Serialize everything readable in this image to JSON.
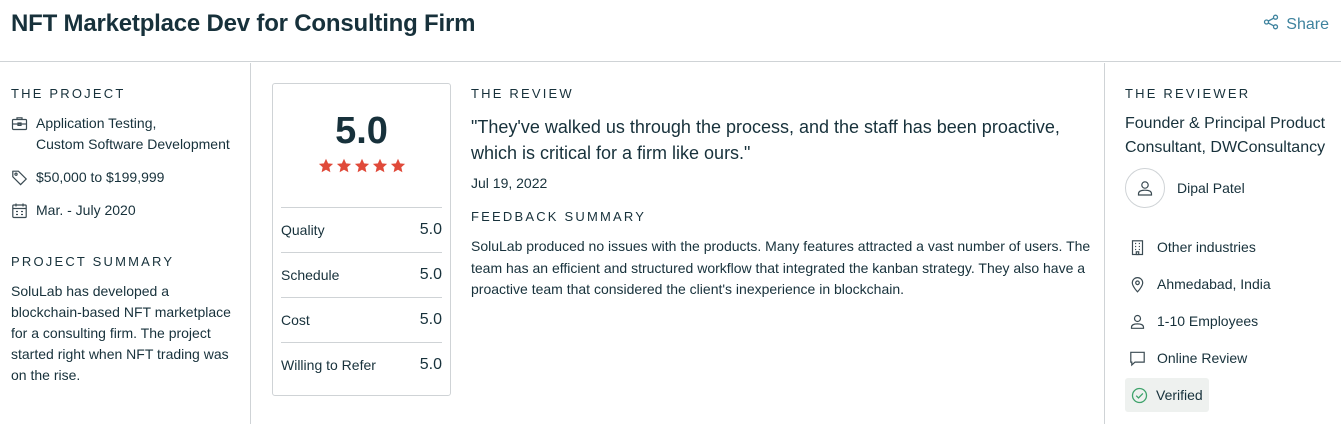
{
  "header": {
    "title": "NFT Marketplace Dev for Consulting Firm",
    "share_label": "Share"
  },
  "project": {
    "heading": "THE PROJECT",
    "services_line1": "Application Testing,",
    "services_line2": "Custom Software Development",
    "budget": "$50,000 to $199,999",
    "timeline": "Mar. - July 2020",
    "summary_heading": "PROJECT SUMMARY",
    "summary_text": "SoluLab has developed a blockchain-based NFT marketplace for a consulting firm. The project started right when NFT trading was on the rise."
  },
  "ratings": {
    "overall": "5.0",
    "star_count": 5,
    "star_color": "#e04a3a",
    "rows": [
      {
        "label": "Quality",
        "value": "5.0"
      },
      {
        "label": "Schedule",
        "value": "5.0"
      },
      {
        "label": "Cost",
        "value": "5.0"
      },
      {
        "label": "Willing to Refer",
        "value": "5.0"
      }
    ]
  },
  "review": {
    "heading": "THE REVIEW",
    "quote": "\"They've walked us through the process, and the staff has been proactive, which is critical for a firm like ours.\"",
    "date": "Jul 19, 2022",
    "feedback_heading": "FEEDBACK SUMMARY",
    "feedback_text": "SoluLab produced no issues with the products. Many features attracted a vast number of users. The team has an efficient and structured workflow that integrated the kanban strategy. They also have a proactive team that considered the client's inexperience in blockchain."
  },
  "reviewer": {
    "heading": "THE REVIEWER",
    "role": "Founder & Principal Product Consultant, DWConsultancy",
    "name": "Dipal Patel",
    "industry": "Other industries",
    "location": "Ahmedabad, India",
    "size": "1-10 Employees",
    "review_type": "Online Review",
    "verified": "Verified"
  },
  "colors": {
    "text": "#17313b",
    "link": "#3e839e",
    "border": "#cfd3d6",
    "verified_bg": "#eef1ef",
    "verified_icon": "#3ea36b"
  }
}
